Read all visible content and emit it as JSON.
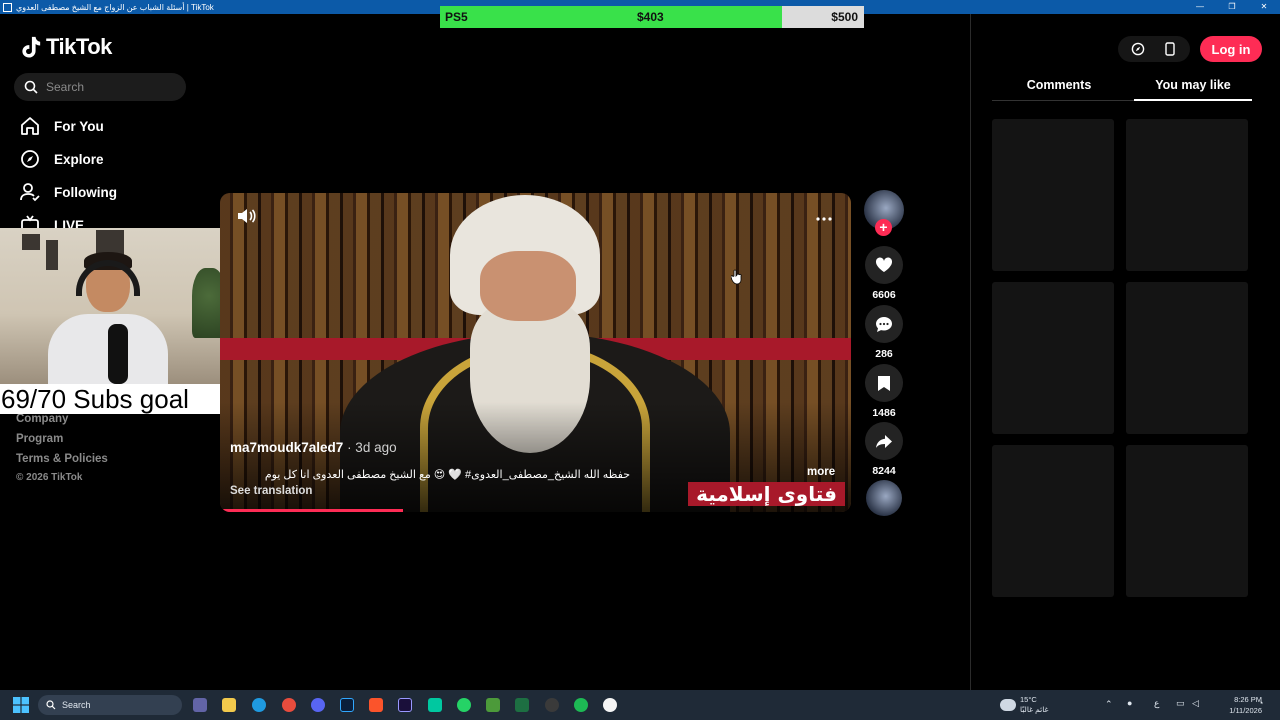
{
  "window": {
    "title": "أسئلة الشباب عن الزواج مع الشيخ مصطفى العدوي | TikTok",
    "controls": [
      "—",
      "❐",
      "✕"
    ]
  },
  "goal_bar": {
    "label": "PS5",
    "current": "$403",
    "target": "$500",
    "progress": 0.806,
    "fill_color": "#39e14a"
  },
  "sidebar": {
    "logo_text": "TikTok",
    "search_placeholder": "Search",
    "nav": [
      {
        "label": "For You",
        "icon": "home-icon"
      },
      {
        "label": "Explore",
        "icon": "compass-icon"
      },
      {
        "label": "Following",
        "icon": "following-icon"
      },
      {
        "label": "LIVE",
        "icon": "live-icon"
      }
    ],
    "footer": [
      "Company",
      "Program",
      "Terms & Policies",
      "© 2026 TikTok"
    ]
  },
  "stream_overlay": {
    "subs_goal": "69/70 Subs goal"
  },
  "video": {
    "author": "ma7moudk7aled7",
    "date": " · 3d ago",
    "caption": "حفظه الله الشيخ_مصطفى_العدوى# 🤍 😍 مع الشيخ مصطفى العدوى انا كل يوم",
    "see_translation": "See translation",
    "more": "more",
    "watermark": "فتاوى إسلامية",
    "progress": 0.29,
    "accent": "#fe2c55"
  },
  "actions": {
    "likes": "6606",
    "comments": "286",
    "saves": "1486",
    "shares": "8244",
    "follow_symbol": "+"
  },
  "right_panel": {
    "login_label": "Log in",
    "tabs": [
      {
        "label": "Comments",
        "active": false
      },
      {
        "label": "You may like",
        "active": true
      }
    ]
  },
  "taskbar": {
    "search_placeholder": "Search",
    "weather_temp": "15°C",
    "weather_desc": "غائم غالبًا",
    "time": "8:26 PM",
    "date": "1/11/2026",
    "lang": "ع"
  }
}
